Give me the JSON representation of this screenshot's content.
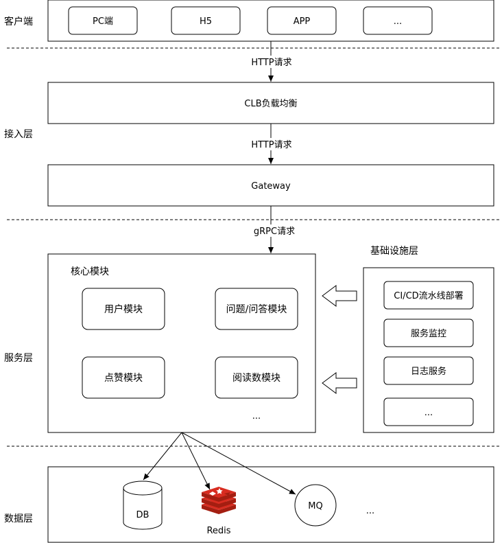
{
  "layers": {
    "client": "客户端",
    "access": "接入层",
    "service": "服务层",
    "data": "数据层"
  },
  "client_items": [
    "PC端",
    "H5",
    "APP",
    "..."
  ],
  "edges": {
    "http1": "HTTP请求",
    "http2": "HTTP请求",
    "grpc": "gRPC请求"
  },
  "access": {
    "clb": "CLB负载均衡",
    "gateway": "Gateway"
  },
  "core": {
    "title": "核心模块",
    "modules": [
      "用户模块",
      "问题/问答模块",
      "点赞模块",
      "阅读数模块"
    ],
    "more": "..."
  },
  "infra": {
    "title": "基础设施层",
    "items": [
      "CI/CD流水线部署",
      "服务监控",
      "日志服务",
      "..."
    ]
  },
  "storage": {
    "db": "DB",
    "redis": "Redis",
    "mq": "MQ",
    "more": "..."
  },
  "colors": {
    "redis_dark": "#a41e11",
    "redis_mid": "#d82c20",
    "redis_light": "#ffffff"
  }
}
